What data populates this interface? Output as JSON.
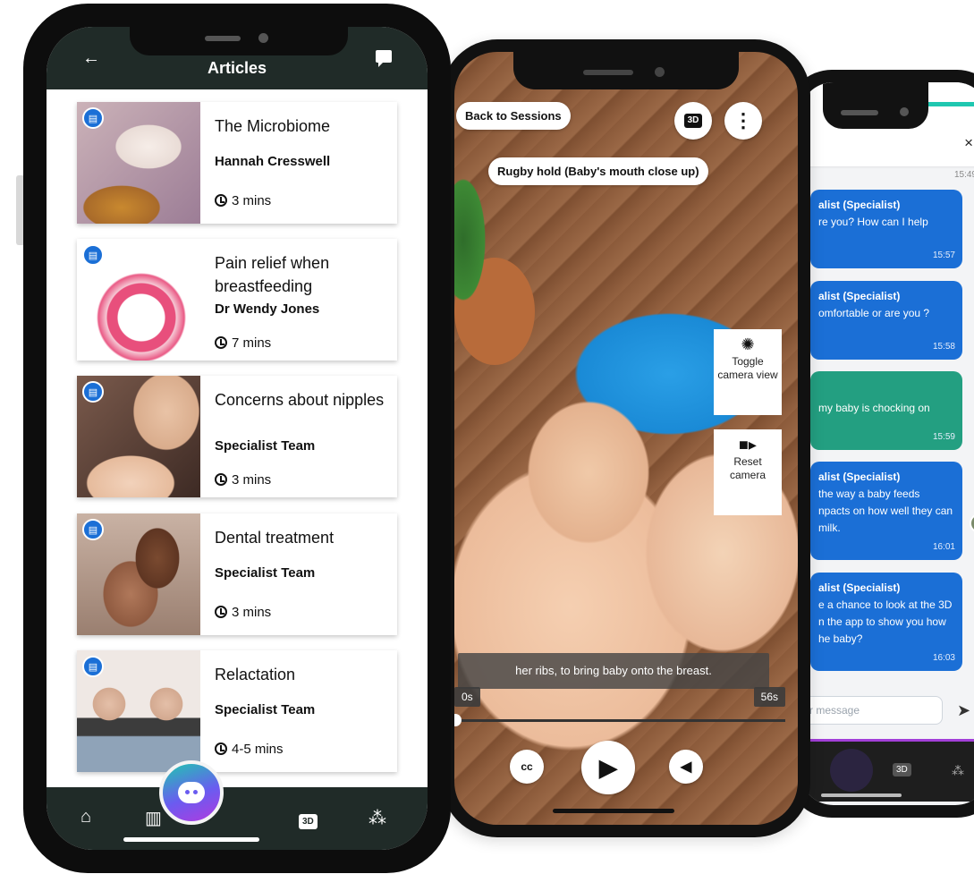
{
  "articles_screen": {
    "title": "Articles",
    "cards": [
      {
        "title": "The Microbiome",
        "author": "Hannah Cresswell",
        "read_time": "3 mins"
      },
      {
        "title": "Pain relief when breastfeeding",
        "author": "Dr Wendy Jones",
        "read_time": "7 mins"
      },
      {
        "title": "Concerns about nipples",
        "author": "Specialist Team",
        "read_time": "3 mins"
      },
      {
        "title": "Dental treatment",
        "author": "Specialist Team",
        "read_time": "3 mins"
      },
      {
        "title": "Relactation",
        "author": "Specialist Team",
        "read_time": "4-5 mins"
      }
    ],
    "nav_3d_label": "3D"
  },
  "video_screen": {
    "back_label": "Back to Sessions",
    "badge_3d": "3D",
    "session_label": "Rugby hold (Baby's mouth close up)",
    "toggle_camera_label": "Toggle camera view",
    "reset_camera_label": "Reset camera",
    "caption": "her ribs, to bring baby onto the breast.",
    "time_start": "0s",
    "time_end": "56s",
    "cc_label": "cc"
  },
  "chat_screen": {
    "close_glyph": "×",
    "first_timestamp": "15:49",
    "messages": [
      {
        "sender": "alist (Specialist)",
        "text": "re you? How can I help",
        "time": "15:57"
      },
      {
        "sender": "alist (Specialist)",
        "text": "omfortable or are you ?",
        "time": "15:58"
      },
      {
        "sender": "",
        "text": "my baby is chocking on",
        "time": "15:59"
      },
      {
        "sender": "alist (Specialist)",
        "text": "the way a baby feeds npacts on how well they can milk.",
        "time": "16:01"
      },
      {
        "sender": "alist (Specialist)",
        "text": "e a chance to look at the 3D n the app to show you how he baby?",
        "time": "16:03"
      }
    ],
    "input_placeholder": "r message",
    "nav_3d_label": "3D"
  },
  "colors": {
    "header_dark": "#202b28",
    "accent_blue": "#1b6fd6",
    "accent_green": "#239f81",
    "teal": "#1fc7b0",
    "purple": "#a23fd8"
  },
  "icons": [
    "back-arrow-icon",
    "chat-icon",
    "article-badge-icon",
    "clock-icon",
    "home-icon",
    "library-icon",
    "assistant-fab-icon",
    "3d-icon",
    "family-icon",
    "more-dots-icon",
    "camera-aperture-icon",
    "video-camera-icon",
    "closed-captions-icon",
    "play-icon",
    "volume-icon",
    "close-icon",
    "send-icon"
  ]
}
